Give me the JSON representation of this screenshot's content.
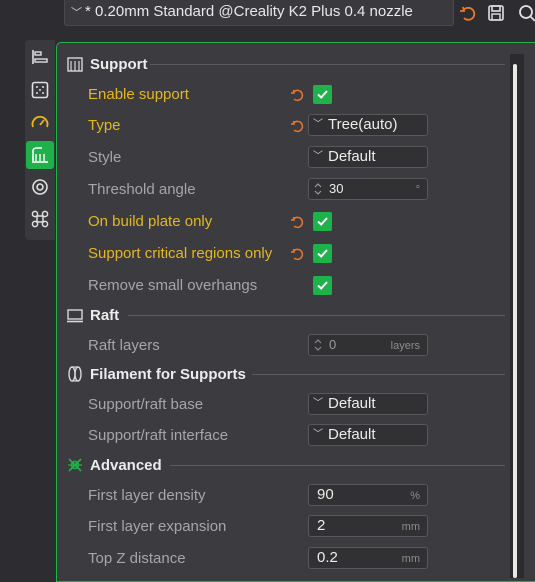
{
  "preset": {
    "label": "* 0.20mm Standard @Creality K2 Plus 0.4 nozzle"
  },
  "sections": {
    "support": "Support",
    "raft": "Raft",
    "filament": "Filament for Supports",
    "advanced": "Advanced"
  },
  "rows": {
    "enable_support": {
      "label": "Enable support",
      "checked": true
    },
    "type": {
      "label": "Type",
      "value": "Tree(auto)"
    },
    "style": {
      "label": "Style",
      "value": "Default"
    },
    "threshold_angle": {
      "label": "Threshold angle",
      "value": "30",
      "unit": "°"
    },
    "on_build_plate_only": {
      "label": "On build plate only",
      "checked": true
    },
    "critical_regions": {
      "label": "Support critical regions only",
      "checked": true
    },
    "remove_small_overhangs": {
      "label": "Remove small overhangs",
      "checked": true
    },
    "raft_layers": {
      "label": "Raft layers",
      "value": "0",
      "unit": "layers"
    },
    "raft_base": {
      "label": "Support/raft base",
      "value": "Default"
    },
    "raft_interface": {
      "label": "Support/raft interface",
      "value": "Default"
    },
    "first_layer_density": {
      "label": "First layer density",
      "value": "90",
      "unit": "%"
    },
    "first_layer_expansion": {
      "label": "First layer expansion",
      "value": "2",
      "unit": "mm"
    },
    "top_z_distance": {
      "label": "Top Z distance",
      "value": "0.2",
      "unit": "mm"
    }
  },
  "colors": {
    "accent": "#1fb14a",
    "modified": "#e4b81a",
    "reset": "#e8782c"
  }
}
